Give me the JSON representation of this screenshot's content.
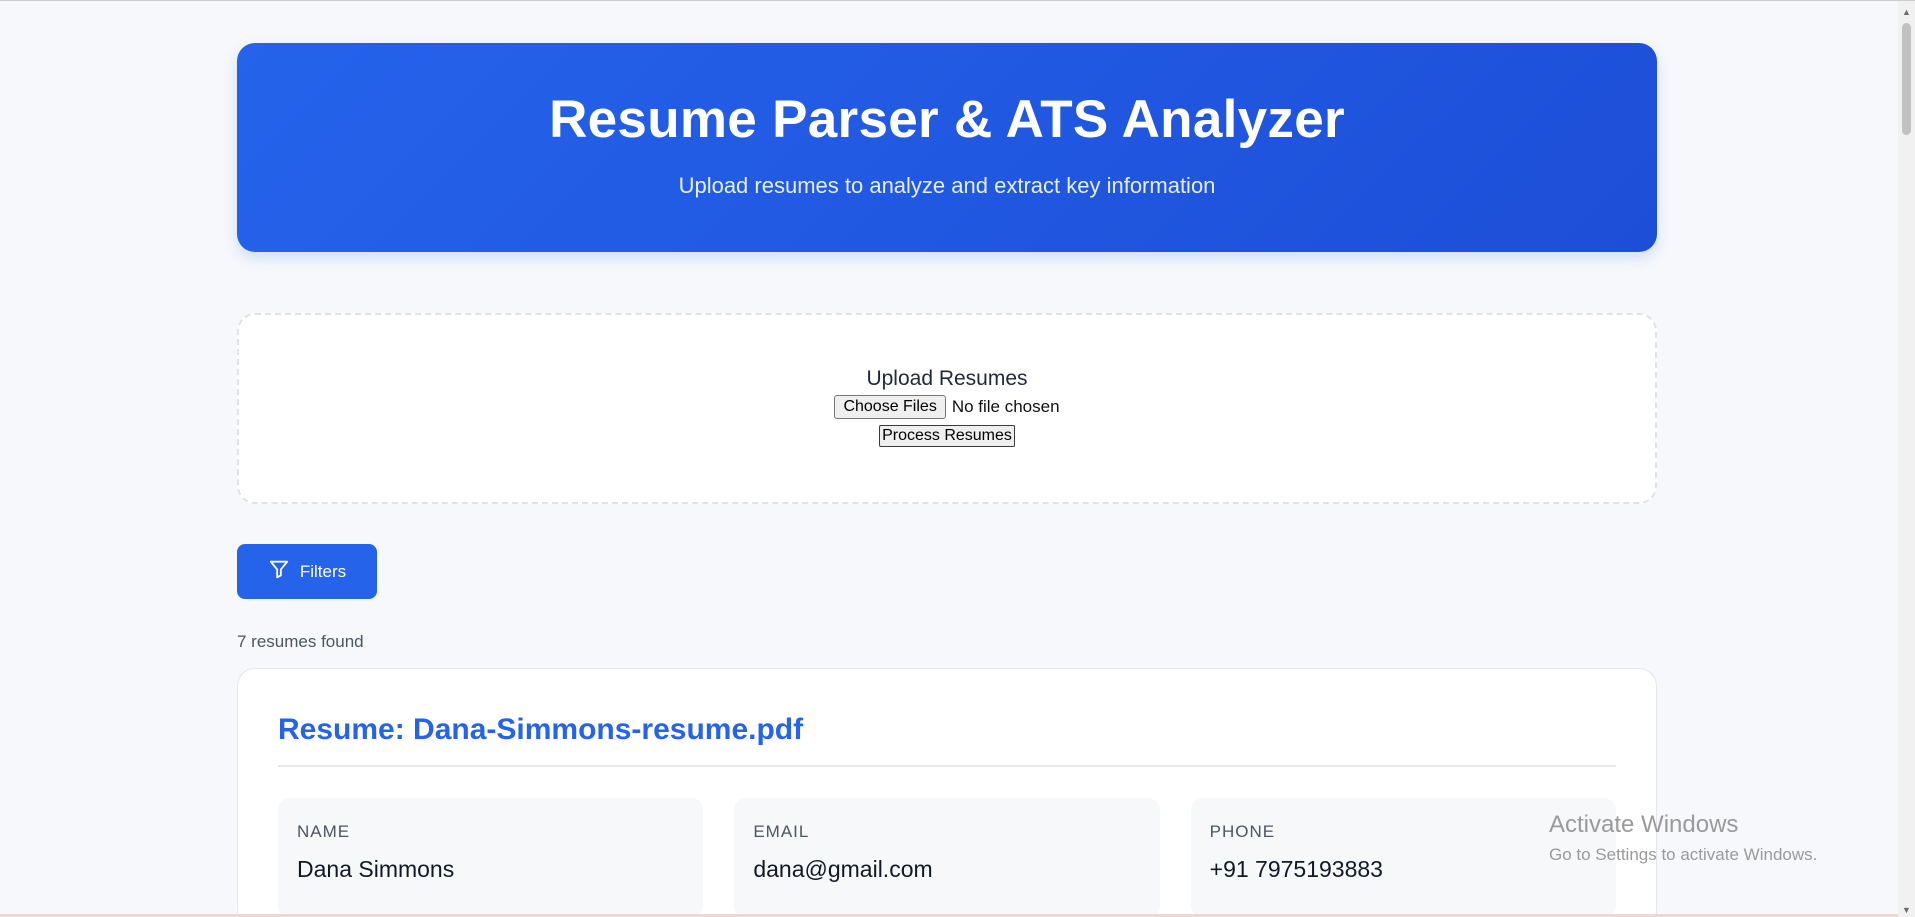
{
  "header": {
    "title": "Resume Parser & ATS Analyzer",
    "subtitle": "Upload resumes to analyze and extract key information"
  },
  "upload": {
    "title": "Upload Resumes",
    "choose_label": "Choose Files",
    "file_status": "No file chosen",
    "process_label": "Process Resumes"
  },
  "filters": {
    "label": "Filters",
    "icon": "filter-icon"
  },
  "results": {
    "count_text": "7 resumes found"
  },
  "resume": {
    "title": "Resume: Dana-Simmons-resume.pdf",
    "fields": [
      {
        "label": "NAME",
        "value": "Dana Simmons"
      },
      {
        "label": "EMAIL",
        "value": "dana@gmail.com"
      },
      {
        "label": "PHONE",
        "value": "+91 7975193883"
      }
    ]
  },
  "overlay": {
    "activate_title": "Activate Windows",
    "activate_subtitle": "Go to Settings to activate Windows."
  },
  "colors": {
    "primary": "#2563eb",
    "primary_dark": "#1d4ed8",
    "page_bg": "#f6f8fb"
  }
}
